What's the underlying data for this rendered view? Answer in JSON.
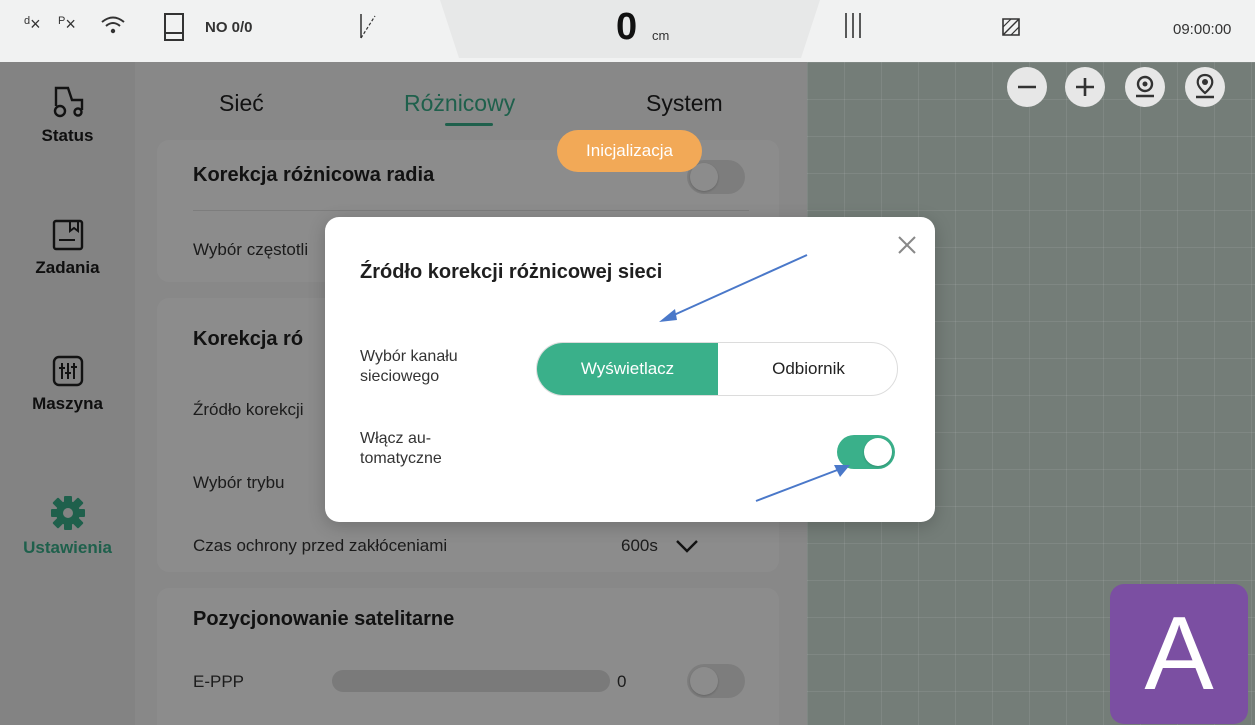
{
  "statusbar": {
    "signal_d": "d",
    "signal_p": "P",
    "task_label": "NO 0/0",
    "distance_value": "0",
    "distance_unit": "cm",
    "time": "09:00:00"
  },
  "nav": {
    "items": [
      {
        "label": "Status",
        "icon": "tractor-icon"
      },
      {
        "label": "Zadania",
        "icon": "task-book-icon"
      },
      {
        "label": "Maszyna",
        "icon": "machine-sliders-icon"
      },
      {
        "label": "Ustawienia",
        "icon": "gear-icon",
        "active": true
      }
    ]
  },
  "tabs": [
    {
      "label": "Sieć"
    },
    {
      "label": "Różnicowy",
      "active": true
    },
    {
      "label": "System"
    }
  ],
  "cards": {
    "radio": {
      "title": "Korekcja różnicowa radia",
      "row1": "Wybór częstotli",
      "toggle_on": false
    },
    "network": {
      "title": "Korekcja ró",
      "row1": "Źródło korekcji",
      "row2": "Wybór trybu",
      "row3": "Czas ochrony przed zakłóceniami",
      "row3_value": "600s"
    },
    "satellite": {
      "title": "Pozycjonowanie satelitarne",
      "row1": "E-PPP",
      "row1_value": "0",
      "row1_progress": 0,
      "toggle_on": false
    }
  },
  "init_badge": "Inicjalizacja",
  "modal": {
    "title": "Źródło korekcji różnicowej sieci",
    "field1_label": "Wybór kanału sieciowego",
    "segment": {
      "options": [
        "Wyświetlacz",
        "Odbiornik"
      ],
      "selected": "Wyświetlacz"
    },
    "field2_label": "Włącz au-\ntomatyczne",
    "field2_toggle_on": true
  },
  "map": {
    "controls": [
      "zoom-out-icon",
      "zoom-in-icon",
      "locate-icon",
      "person-location-icon"
    ],
    "mode_badge": "A"
  },
  "colors": {
    "accent": "#3ab08a",
    "orange": "#f2a957",
    "purple": "#7b4fa2",
    "arrow": "#4a78c9"
  }
}
